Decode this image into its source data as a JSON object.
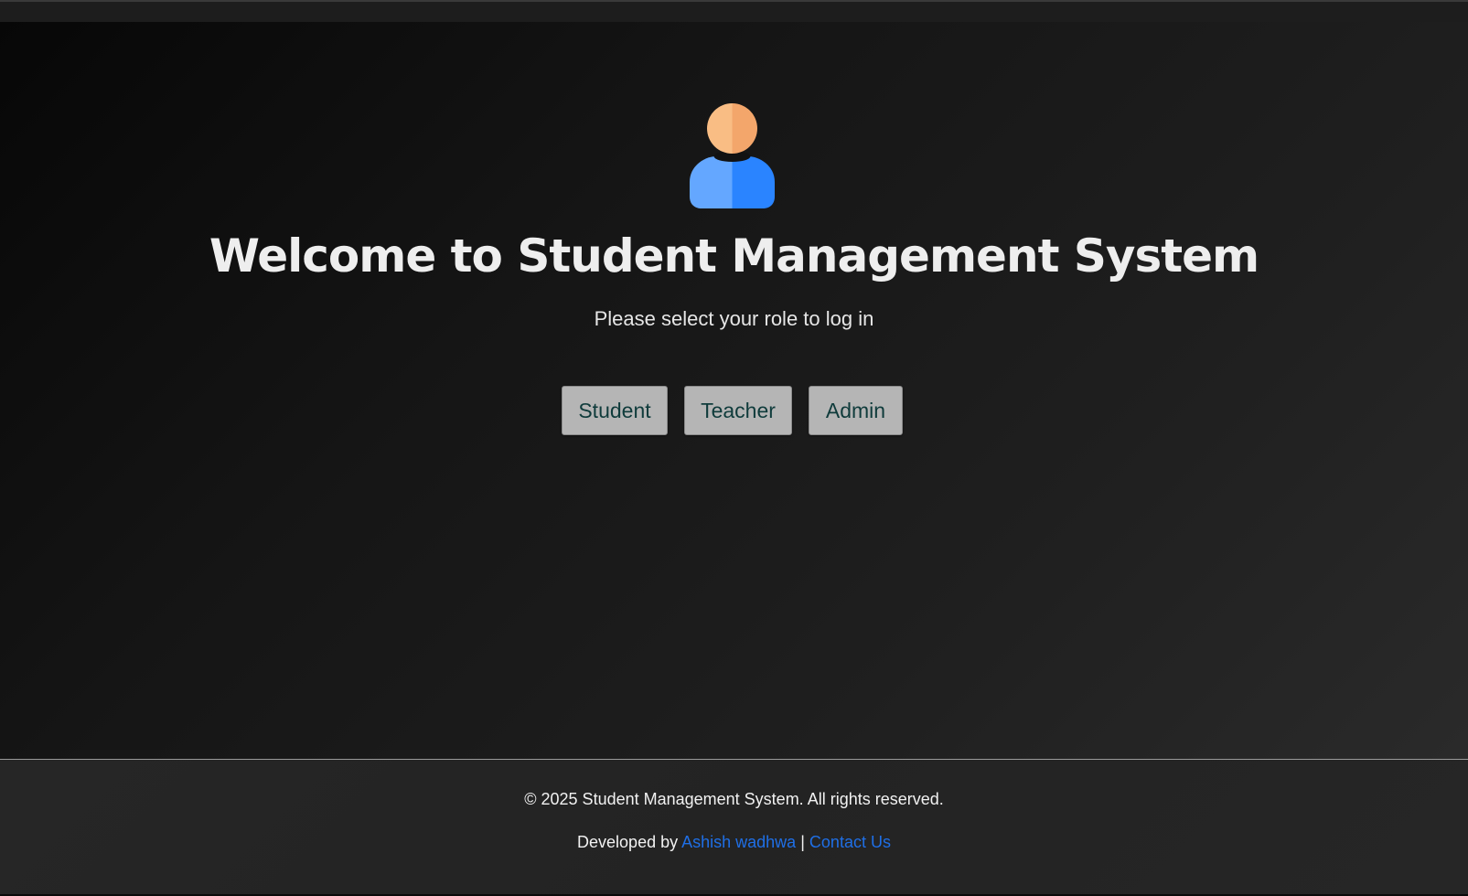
{
  "hero": {
    "icon": "user-avatar-icon",
    "title": "Welcome to Student Management System",
    "subtitle": "Please select your role to log in"
  },
  "roles": {
    "student": "Student",
    "teacher": "Teacher",
    "admin": "Admin"
  },
  "footer": {
    "copyright": "© 2025 Student Management System. All rights reserved.",
    "developed_by_prefix": "Developed by",
    "developer_name": "Ashish wadhwa",
    "separator": "|",
    "contact_label": "Contact Us"
  },
  "colors": {
    "button_bg": "#b5b5b5",
    "button_text": "#0f3b3b",
    "link": "#1f6fe6",
    "avatar_head_light": "#f9bd84",
    "avatar_head_dark": "#f3a66b",
    "avatar_body_light": "#64a7ff",
    "avatar_body_dark": "#2a84ff"
  }
}
